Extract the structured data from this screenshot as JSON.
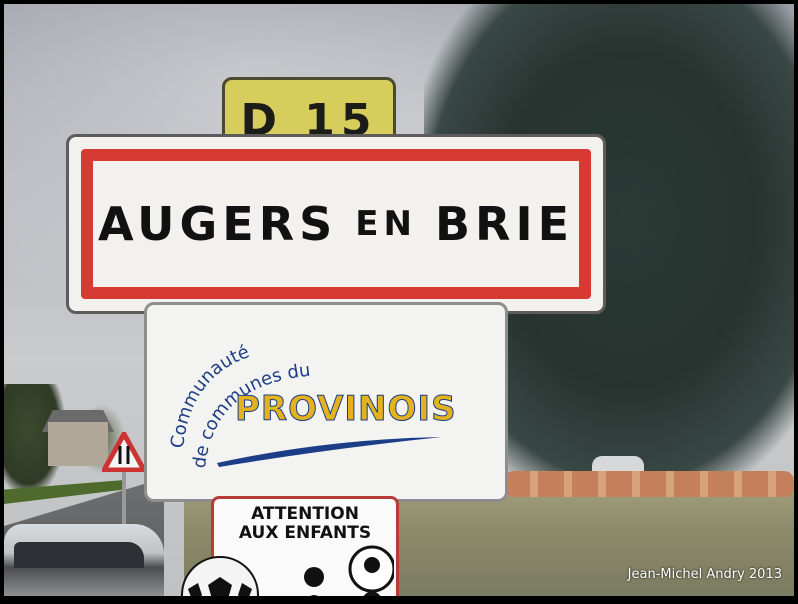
{
  "photo": {
    "road_number_sign": {
      "text": "D 15"
    },
    "town_sign": {
      "part1": "AUGERS",
      "part2": "EN",
      "part3": "BRIE"
    },
    "community_sign": {
      "line1": "Communauté",
      "line2": "de communes du",
      "brand": "PROVINOIS"
    },
    "warning_sign": {
      "line1": "ATTENTION",
      "line2": "AUX ENFANTS"
    },
    "credit": "Jean-Michel  Andry 2013"
  },
  "colors": {
    "town_border": "#d63a33",
    "road_sign_yellow": "#d6cd5c",
    "brand_yellow": "#e4b21c",
    "brand_blue": "#1c3d87"
  },
  "icons": [
    "warning-triangle-icon",
    "soccer-ball-icon",
    "children-icon"
  ]
}
